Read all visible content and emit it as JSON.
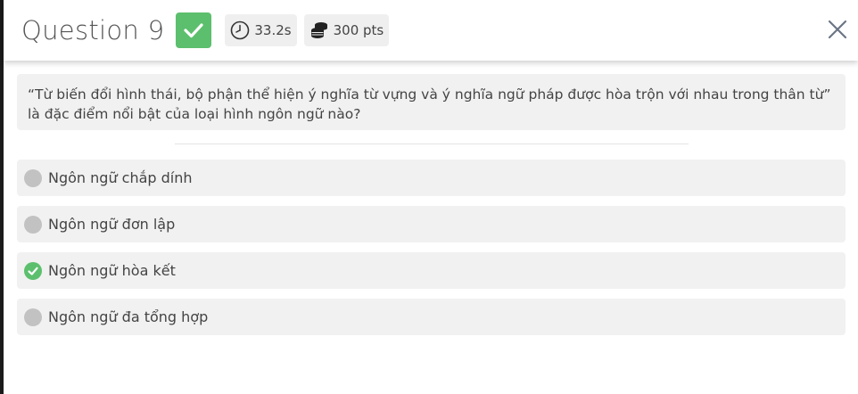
{
  "header": {
    "title": "Question 9",
    "timer": "33.2s",
    "points": "300 pts"
  },
  "question": {
    "text": "“Từ biến đổi hình thái, bộ phận thể hiện ý nghĩa từ vựng và ý nghĩa ngữ pháp được hòa trộn với nhau trong thân từ” là đặc điểm nổi bật của loại hình ngôn ngữ nào?"
  },
  "options": [
    {
      "label": "Ngôn ngữ chắp dính",
      "correct": false
    },
    {
      "label": "Ngôn ngữ đơn lập",
      "correct": false
    },
    {
      "label": "Ngôn ngữ hòa kết",
      "correct": true
    },
    {
      "label": "Ngôn ngữ đa tổng hợp",
      "correct": false
    }
  ],
  "colors": {
    "accent_green": "#5cbf6d",
    "neutral_dot": "#c2c2c2",
    "panel_bg": "#f1f1f1"
  },
  "icons": {
    "badge": "checkmark-icon",
    "timer": "clock-icon",
    "points": "coins-icon",
    "close": "close-icon"
  }
}
